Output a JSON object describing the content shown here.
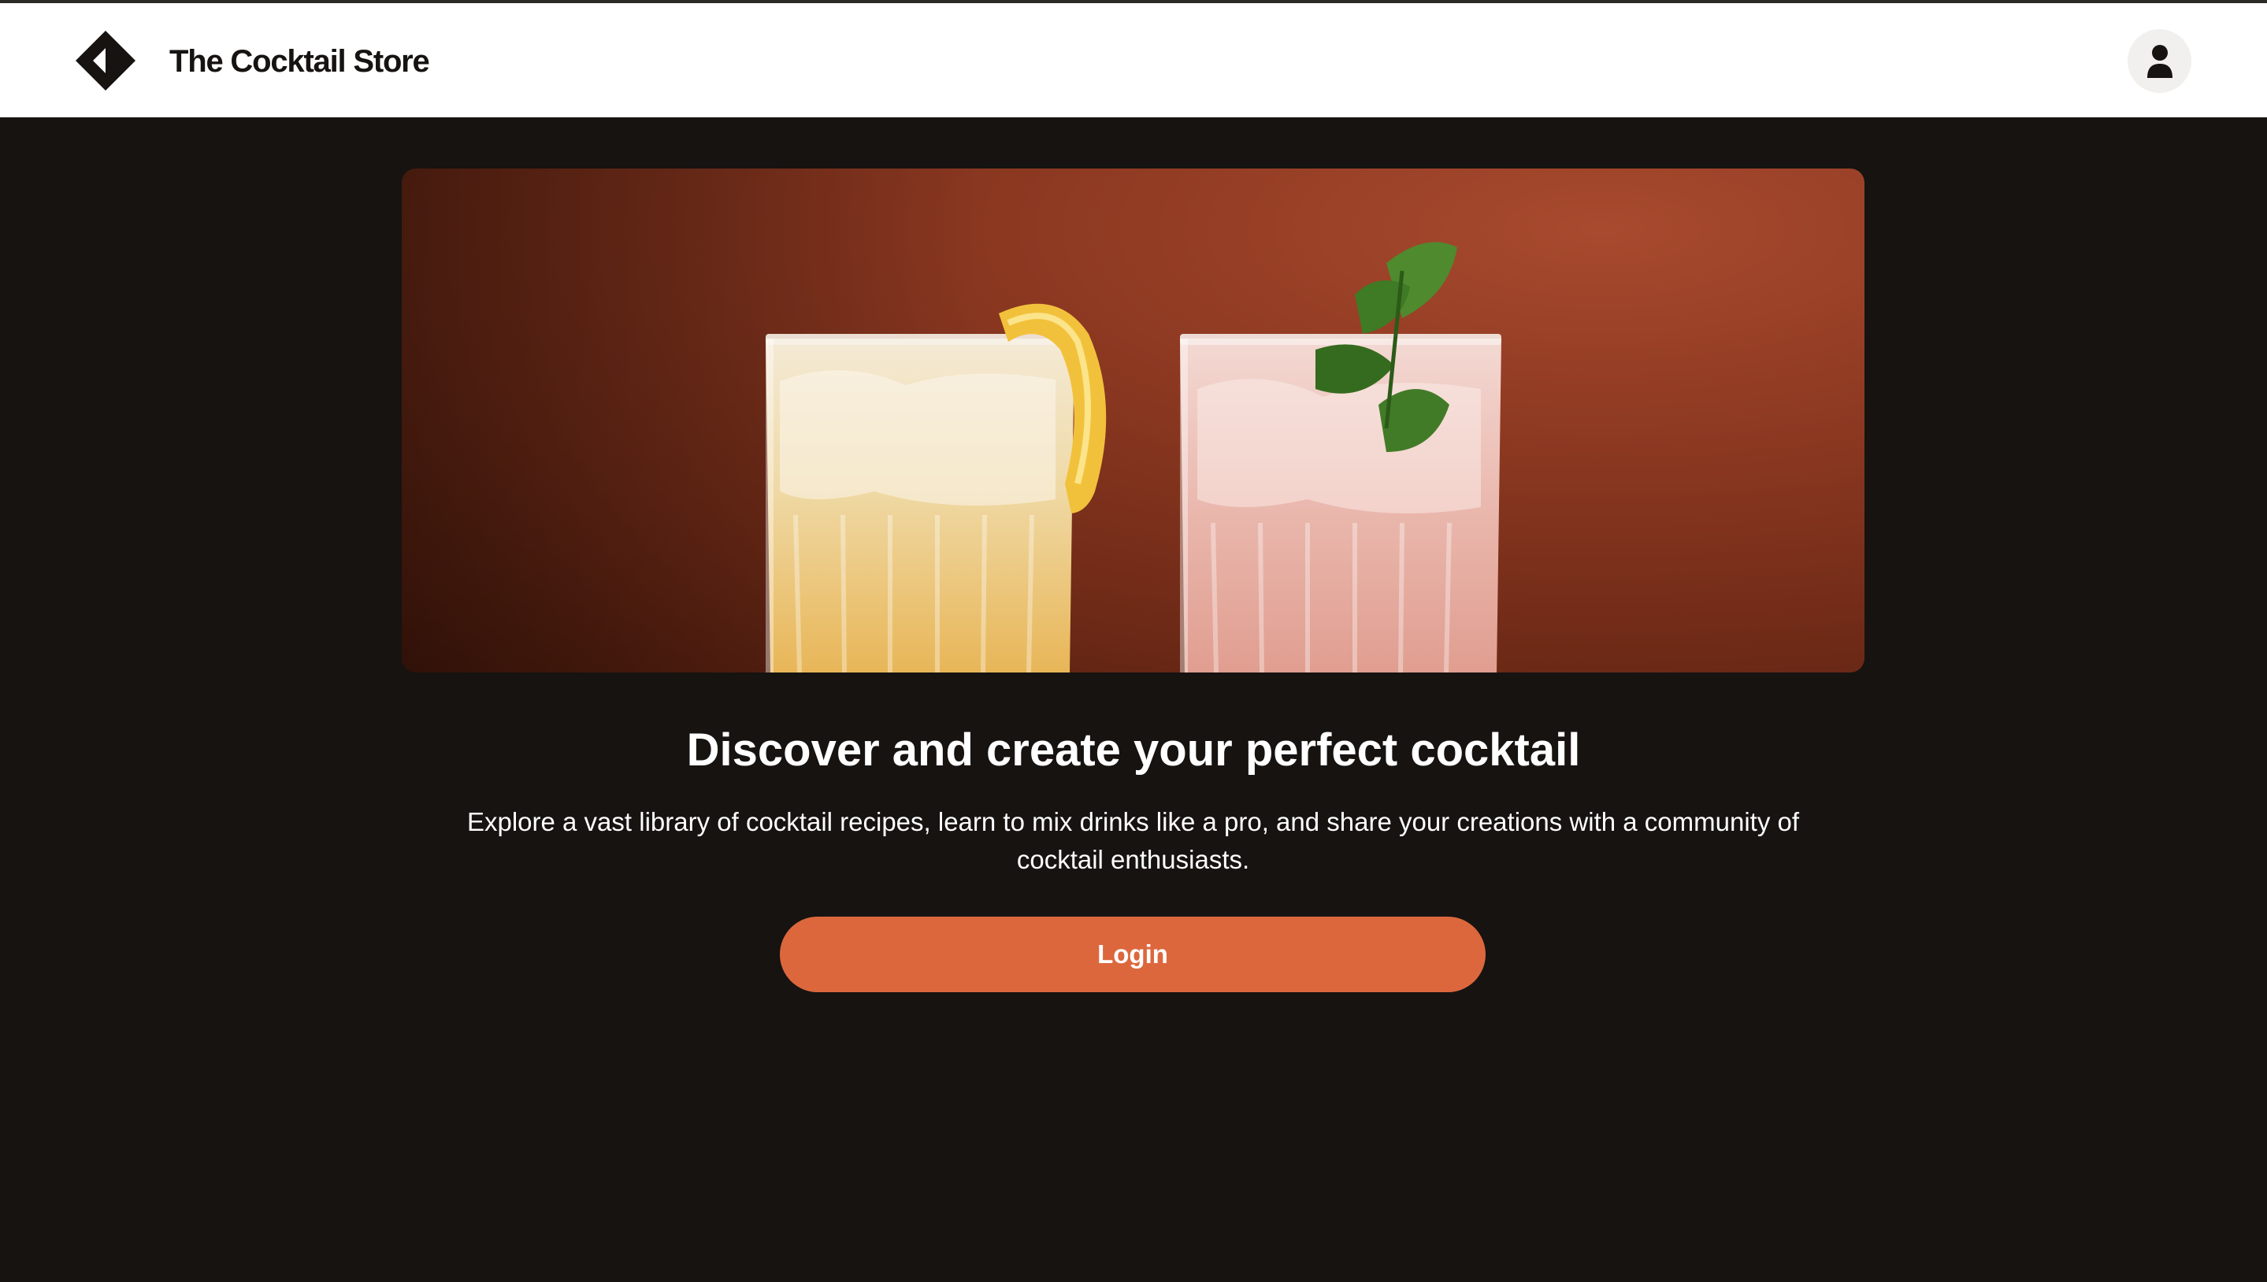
{
  "header": {
    "brand": "The Cocktail Store",
    "logo_icon": "diamond-logo-icon",
    "user_icon": "user-icon"
  },
  "hero": {
    "image_alt": "Two cocktail glasses, one with lemon and one with mint"
  },
  "main": {
    "headline": "Discover and create your perfect cocktail",
    "description": "Explore a vast library of cocktail recipes, learn to mix drinks like a pro, and share your creations with a community of cocktail enthusiasts.",
    "login_label": "Login"
  },
  "colors": {
    "background": "#161311",
    "header": "#ffffff",
    "accent": "#dc673d"
  }
}
